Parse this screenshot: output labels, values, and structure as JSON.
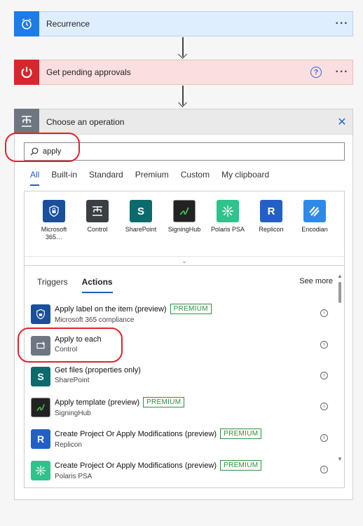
{
  "steps": [
    {
      "title": "Recurrence",
      "more": "···",
      "icon": "alarm-clock-icon",
      "color": "#1f7be6"
    },
    {
      "title": "Get pending approvals",
      "more": "···",
      "help": "?",
      "icon": "power-icon",
      "color": "#d7262c"
    }
  ],
  "panel": {
    "title": "Choose an operation",
    "close": "✕",
    "search_value": "apply",
    "tabs": [
      "All",
      "Built-in",
      "Standard",
      "Premium",
      "Custom",
      "My clipboard"
    ],
    "active_tab": "All"
  },
  "connectors": [
    {
      "label": "Microsoft 365…",
      "icon": "shield-lock-icon",
      "color": "#1a4f9c"
    },
    {
      "label": "Control",
      "icon": "control-icon",
      "color": "#3b3f44"
    },
    {
      "label": "SharePoint",
      "icon": "sharepoint-icon",
      "color": "#0b6a6c"
    },
    {
      "label": "SigningHub",
      "icon": "signature-icon",
      "color": "#222222"
    },
    {
      "label": "Polaris PSA",
      "icon": "polaris-icon",
      "color": "#2dc38b"
    },
    {
      "label": "Replicon",
      "icon": "replicon-r-icon",
      "color": "#2460c4"
    },
    {
      "label": "Encodian",
      "icon": "encodian-stripes-icon",
      "color": "#2e8ae6"
    }
  ],
  "results": {
    "tabs": [
      "Triggers",
      "Actions"
    ],
    "active_tab": "Actions",
    "see_more": "See more",
    "items": [
      {
        "name": "Apply label on the item (preview)",
        "badge": "PREMIUM",
        "sub": "Microsoft 365 compliance",
        "icon": "shield-lock-icon",
        "color": "#1a4f9c"
      },
      {
        "name": "Apply to each",
        "badge": "",
        "sub": "Control",
        "icon": "loop-icon",
        "color": "#6e7781"
      },
      {
        "name": "Get files (properties only)",
        "badge": "",
        "sub": "SharePoint",
        "icon": "sharepoint-icon",
        "color": "#0b6a6c"
      },
      {
        "name": "Apply template (preview)",
        "badge": "PREMIUM",
        "sub": "SigningHub",
        "icon": "signature-icon",
        "color": "#222222"
      },
      {
        "name": "Create Project Or Apply Modifications (preview)",
        "badge": "PREMIUM",
        "sub": "Replicon",
        "icon": "replicon-r-icon",
        "color": "#2460c4"
      },
      {
        "name": "Create Project Or Apply Modifications (preview)",
        "badge": "PREMIUM",
        "sub": "Polaris PSA",
        "icon": "polaris-icon",
        "color": "#2dc38b"
      }
    ]
  }
}
